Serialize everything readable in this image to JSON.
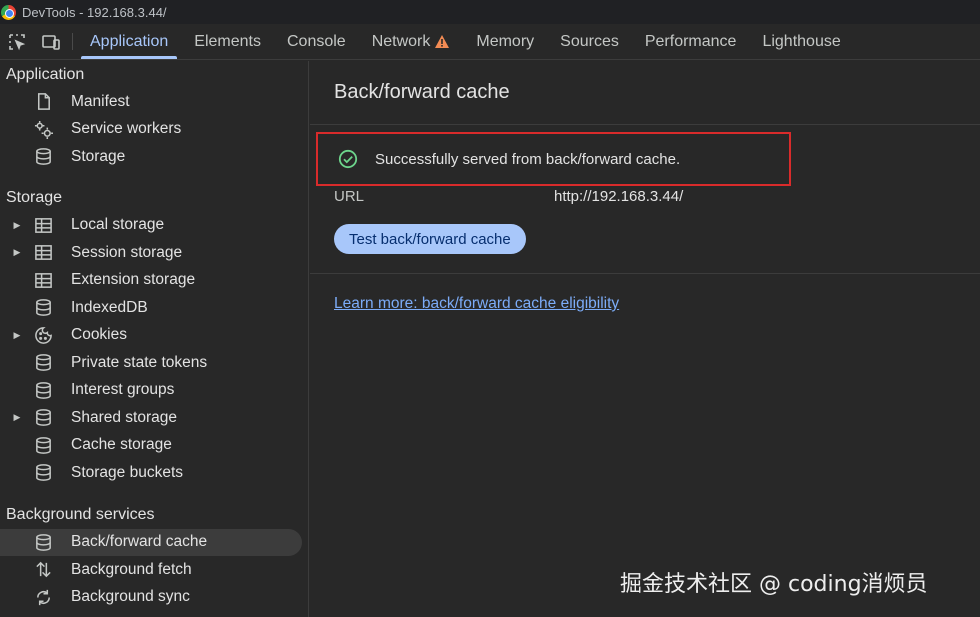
{
  "window": {
    "title": "DevTools - 192.168.3.44/"
  },
  "tabs": [
    {
      "label": "Application",
      "active": true
    },
    {
      "label": "Elements"
    },
    {
      "label": "Console"
    },
    {
      "label": "Network",
      "warning": true
    },
    {
      "label": "Memory"
    },
    {
      "label": "Sources"
    },
    {
      "label": "Performance"
    },
    {
      "label": "Lighthouse"
    }
  ],
  "sidebar": {
    "application": {
      "heading": "Application",
      "items": [
        {
          "label": "Manifest",
          "icon": "document-icon"
        },
        {
          "label": "Service workers",
          "icon": "gears-icon"
        },
        {
          "label": "Storage",
          "icon": "database-icon"
        }
      ]
    },
    "storage": {
      "heading": "Storage",
      "items": [
        {
          "label": "Local storage",
          "icon": "table-icon",
          "expandable": true
        },
        {
          "label": "Session storage",
          "icon": "table-icon",
          "expandable": true
        },
        {
          "label": "Extension storage",
          "icon": "table-icon"
        },
        {
          "label": "IndexedDB",
          "icon": "database-icon"
        },
        {
          "label": "Cookies",
          "icon": "cookie-icon",
          "expandable": true
        },
        {
          "label": "Private state tokens",
          "icon": "database-icon"
        },
        {
          "label": "Interest groups",
          "icon": "database-icon"
        },
        {
          "label": "Shared storage",
          "icon": "database-icon",
          "expandable": true
        },
        {
          "label": "Cache storage",
          "icon": "database-icon"
        },
        {
          "label": "Storage buckets",
          "icon": "database-icon"
        }
      ]
    },
    "background": {
      "heading": "Background services",
      "items": [
        {
          "label": "Back/forward cache",
          "icon": "database-icon",
          "selected": true
        },
        {
          "label": "Background fetch",
          "icon": "arrows-updown-icon"
        },
        {
          "label": "Background sync",
          "icon": "sync-icon"
        }
      ]
    }
  },
  "main": {
    "title": "Back/forward cache",
    "status": "Successfully served from back/forward cache.",
    "url_label": "URL",
    "url_value": "http://192.168.3.44/",
    "test_button": "Test back/forward cache",
    "learn_more": "Learn more: back/forward cache eligibility"
  },
  "watermark": "掘金技术社区 @ coding消烦员",
  "colors": {
    "accent": "#a8c7fa",
    "highlight_border": "#d92b2b",
    "success": "#6dd58c",
    "warning": "#f28b54",
    "link": "#7cacf8"
  }
}
